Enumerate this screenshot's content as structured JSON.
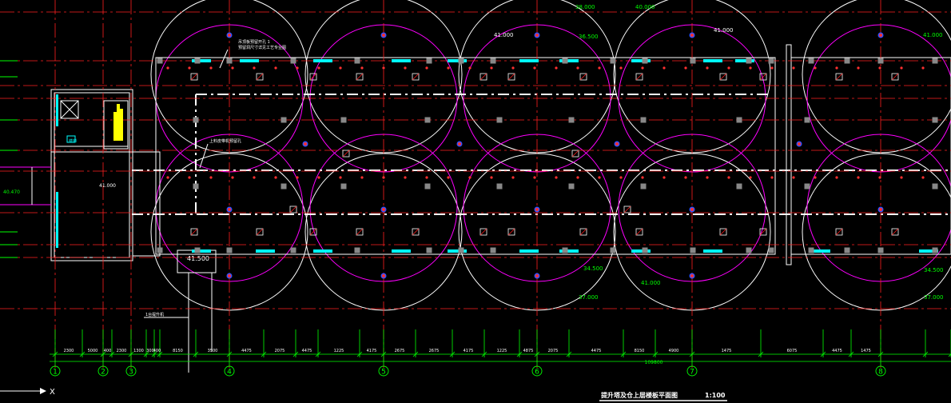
{
  "drawing": {
    "title": "提升塔及仓上层楼板平面图",
    "scale": "1:100",
    "total_dimension": "109800",
    "axis_labels": [
      "1",
      "2",
      "3",
      "4",
      "5",
      "6",
      "7",
      "8"
    ],
    "dimensions": [
      "2300",
      "5000",
      "400",
      "2300",
      "1300",
      "300",
      "400",
      "8150",
      "3500",
      "4475",
      "2075",
      "4475",
      "1225",
      "4175",
      "2675",
      "2675",
      "4175",
      "1225",
      "4875",
      "2075",
      "4475",
      "8150",
      "4900",
      "1475",
      "6075",
      "4475",
      "1475"
    ],
    "elevations": {
      "top_left": "38.000",
      "top_right": "40.000",
      "mid_left": "36.500",
      "bay_left": "41.000",
      "bay_right": "41.000",
      "far_right": "41.000",
      "tower": "41.000",
      "tower_box": "41.500",
      "bottom_left": "34.500",
      "bottom_mid": "41.000",
      "bottom_low": "37.000",
      "bottom_right": "34.500",
      "bottom_right_low": "37.000",
      "left_edge": "40.470"
    },
    "annotations": {
      "top_note": "吊顶板预留开孔 1",
      "top_note_2": "预留洞尺寸详见工艺专业图",
      "mid_note": "上料皮带机预留孔",
      "bottom_note": "1台提升机",
      "tower_note": "楼梯"
    },
    "ucs_label": "X",
    "colors": {
      "background": "#000000",
      "axis_line": "#ff2020",
      "silo_outline": "#ffffff",
      "silo_inner": "#ff00ff",
      "dimension": "#00ff00",
      "column": "#888888",
      "cyan": "#00ffff",
      "yellow": "#ffff00",
      "text": "#ffffff"
    }
  }
}
